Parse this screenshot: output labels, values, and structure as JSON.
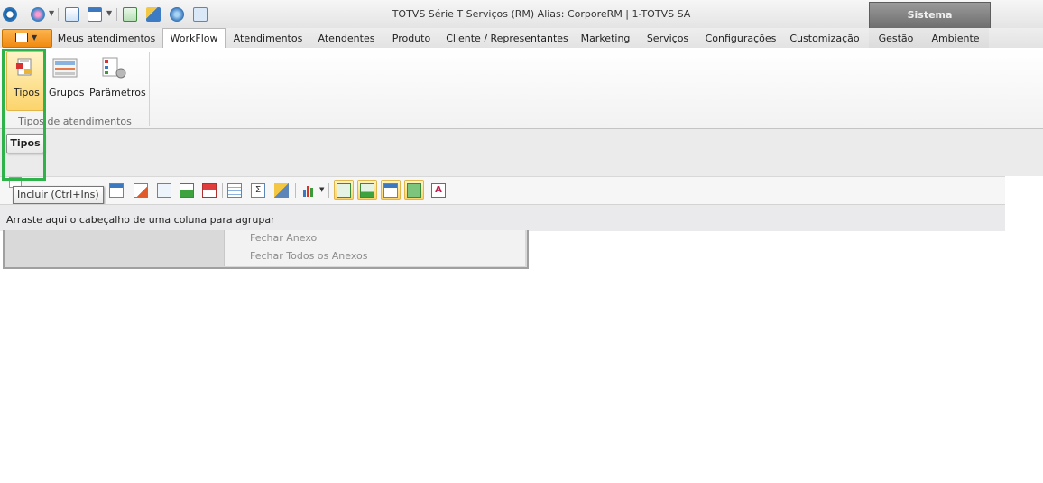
{
  "window": {
    "title": "TOTVS Série T Serviços (RM) Alias: CorporeRM | 1-TOTVS SA",
    "system_label": "Sistema"
  },
  "tabs": [
    {
      "label": "Meus atendimentos"
    },
    {
      "label": "WorkFlow"
    },
    {
      "label": "Atendimentos"
    },
    {
      "label": "Atendentes"
    },
    {
      "label": "Produto"
    },
    {
      "label": "Cliente / Representantes"
    },
    {
      "label": "Marketing"
    },
    {
      "label": "Serviços"
    },
    {
      "label": "Configurações"
    },
    {
      "label": "Customização"
    },
    {
      "label": "Gestão"
    },
    {
      "label": "Ambiente"
    }
  ],
  "ribbon": {
    "buttons": [
      {
        "label": "Tipos"
      },
      {
        "label": "Grupos"
      },
      {
        "label": "Parâmetros"
      }
    ],
    "group_label": "Tipos de atendimentos"
  },
  "document_tab": "Tipos",
  "toolbar": {
    "tooltip": "Incluir (Ctrl+Ins)"
  },
  "grid": {
    "group_hint": "Arraste aqui o cabeçalho de uma coluna para agrupar"
  },
  "context_menu": {
    "items": [
      {
        "label": "Fechar Anexo"
      },
      {
        "label": "Fechar Todos os Anexos"
      }
    ]
  },
  "colors": {
    "highlight": "#2db34a",
    "app_button": "#f08a12",
    "selected": "#fcd56a"
  }
}
